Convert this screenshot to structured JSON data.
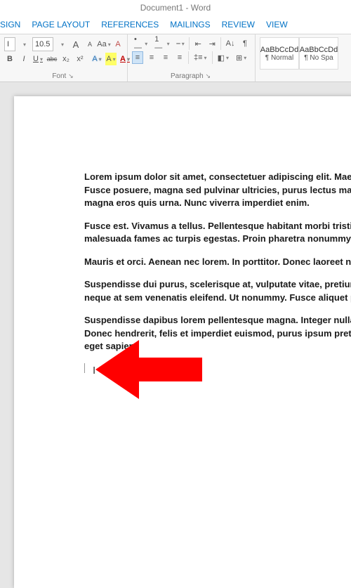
{
  "title": "Document1 - Word",
  "tabs": [
    "SIGN",
    "PAGE LAYOUT",
    "REFERENCES",
    "MAILINGS",
    "REVIEW",
    "VIEW"
  ],
  "font": {
    "name_visible": "I",
    "size": "10.5",
    "grow": "A",
    "shrink": "A",
    "case": "Aa",
    "clear": "A",
    "bold": "B",
    "italic": "I",
    "underline": "U",
    "strike": "abc",
    "sub": "x₂",
    "sup": "x²",
    "textfx": "A",
    "highlight": "A",
    "color": "A"
  },
  "paragraph": {
    "bullets": "•—",
    "numbers": "1—",
    "multilevel": "⎯",
    "dec": "⇤",
    "inc": "⇥",
    "sort": "A↓",
    "marks": "¶",
    "al": "≡",
    "ac": "≡",
    "ar": "≡",
    "aj": "≡",
    "ls": "‡≡",
    "shade": "◧",
    "border": "⊞"
  },
  "styles": [
    {
      "sample": "AaBbCcDd",
      "name": "¶ Normal"
    },
    {
      "sample": "AaBbCcDd",
      "name": "¶ No Spa"
    }
  ],
  "group_labels": {
    "font": "Font",
    "paragraph": "Paragraph"
  },
  "body": [
    "Lorem ipsum dolor sit amet, consectetuer adipiscing elit. Maecenas",
    "Fusce posuere, magna sed pulvinar ultricies, purus lectus malesuad",
    "magna eros quis urna. Nunc viverra imperdiet enim.",
    "Fusce est. Vivamus a tellus. Pellentesque habitant morbi tristique",
    "malesuada fames ac turpis egestas. Proin pharetra nonummy pede.",
    "Mauris et orci. Aenean nec lorem. In porttitor. Donec laoreet nonummy",
    "Suspendisse dui purus, scelerisque at, vulputate vitae, pretium matt",
    "neque at sem venenatis eleifend. Ut nonummy. Fusce aliquet pede non",
    "Suspendisse dapibus lorem pellentesque magna. Integer nulla. Donec",
    "Donec hendrerit, felis et imperdiet euismod, purus ipsum pretium met",
    "eget sapien."
  ]
}
